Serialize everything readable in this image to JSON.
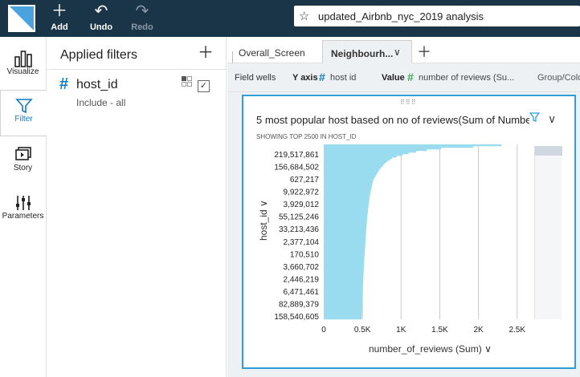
{
  "toolbar": {
    "add_label": "Add",
    "undo_label": "Undo",
    "redo_label": "Redo",
    "analysis_title": "updated_Airbnb_nyc_2019 analysis",
    "colors": {
      "bar_bg": "#1b3548",
      "logo": "#4aa3df"
    }
  },
  "left_rail": {
    "items": [
      {
        "label": "Visualize",
        "icon": "bar-chart-icon"
      },
      {
        "label": "Filter",
        "icon": "funnel-icon",
        "active": true
      },
      {
        "label": "Story",
        "icon": "story-icon"
      },
      {
        "label": "Parameters",
        "icon": "sliders-icon"
      }
    ]
  },
  "filter_panel": {
    "title": "Applied filters",
    "field_name": "host_id",
    "field_desc": "Include - all"
  },
  "tabs": {
    "items": [
      {
        "label": "Overall_Screen"
      },
      {
        "label": "Neighbourh...",
        "active": true
      }
    ]
  },
  "field_wells": {
    "label": "Field wells",
    "y_axis_label": "Y axis",
    "y_axis_field": "host id",
    "value_label": "Value",
    "value_field": "number of reviews (Su...",
    "group_label": "Group/Colo"
  },
  "visual": {
    "title": "5 most popular host based on no of reviews(Sum of Number...",
    "subtitle": "SHOWING TOP 2500 IN HOST_ID",
    "colors": {
      "bar": "#99dcef",
      "border": "#2c9fd6"
    }
  },
  "chart_data": {
    "type": "bar",
    "orientation": "horizontal",
    "title": "5 most popular host based on no of reviews(Sum of Number...",
    "subtitle": "SHOWING TOP 2500 IN HOST_ID",
    "xlabel": "number_of_reviews (Sum)",
    "ylabel": "host_id",
    "xlim": [
      0,
      2700
    ],
    "x_ticks": [
      "0",
      "0.5K",
      "1K",
      "1.5K",
      "2K",
      "2.5K"
    ],
    "y_tick_labels": [
      "219,517,861",
      "156,684,502",
      "627,217",
      "9,922,972",
      "3,929,012",
      "55,125,246",
      "33,213,436",
      "2,377,104",
      "170,510",
      "3,660,702",
      "2,446,219",
      "6,471,461",
      "82,889,379",
      "158,540,605"
    ],
    "profile_positions": [
      0,
      0.01,
      0.02,
      0.04,
      0.07,
      0.1,
      0.14,
      0.2,
      0.28,
      0.36,
      0.45,
      0.55,
      0.65,
      0.78,
      0.9,
      1.0
    ],
    "profile_values": [
      2300,
      1900,
      1450,
      1150,
      900,
      800,
      720,
      640,
      600,
      575,
      555,
      540,
      525,
      510,
      500,
      490
    ],
    "grid": true,
    "legend": "none"
  }
}
